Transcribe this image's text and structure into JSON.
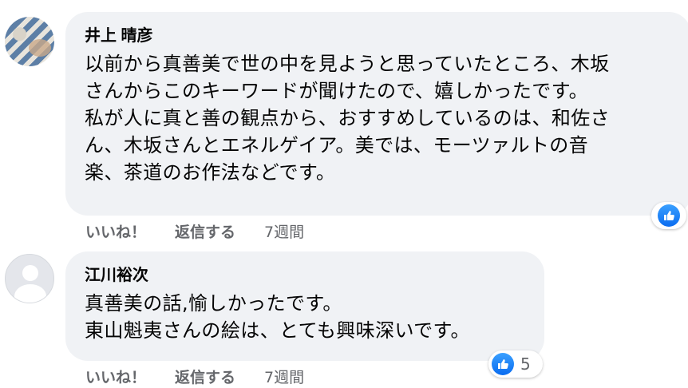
{
  "comments": [
    {
      "author": "井上 晴彦",
      "text": "以前から真善美で世の中を見ようと思っていたところ、木坂\nさんからこのキーワードが聞けたので、嬉しかったです。\n私が人に真と善の観点から、おすすめしているのは、和佐さ\nん、木坂さんとエネルゲイア。美では、モーツァルトの音\n楽、茶道のお作法などです。",
      "like_label": "いいね！",
      "reply_label": "返信する",
      "time": "7週間",
      "reaction_icon": "thumbs-up-icon",
      "reaction_count": ""
    },
    {
      "author": "江川裕次",
      "text": "真善美の話,愉しかったです。\n東山魁夷さんの絵は、とても興味深いです。",
      "like_label": "いいね！",
      "reply_label": "返信する",
      "time": "7週間",
      "reaction_icon": "thumbs-up-icon",
      "reaction_count": "5"
    }
  ],
  "colors": {
    "bubble": "#f0f2f5",
    "secondary_text": "#65676b",
    "like_blue": "#1877f2"
  }
}
